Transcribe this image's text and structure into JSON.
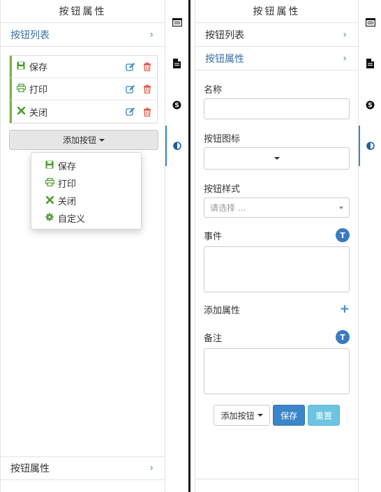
{
  "left_panel": {
    "title": "按钮属性",
    "nav_top": {
      "label": "按钮列表",
      "chevron": "›"
    },
    "buttons": [
      {
        "icon": "save-icon",
        "label": "保存"
      },
      {
        "icon": "print-icon",
        "label": "打印"
      },
      {
        "icon": "close-icon",
        "label": "关闭"
      }
    ],
    "add_button_label": "添加按钮",
    "dropdown": [
      {
        "icon": "save-icon",
        "label": "保存"
      },
      {
        "icon": "print-icon",
        "label": "打印"
      },
      {
        "icon": "close-icon",
        "label": "关闭"
      },
      {
        "icon": "gear-icon",
        "label": "自定义"
      }
    ],
    "nav_bottom": {
      "label": "按钮属性",
      "chevron": "›"
    }
  },
  "rail_icons": [
    "list-icon",
    "document-icon",
    "skype-icon",
    "contrast-icon"
  ],
  "right_panel": {
    "title": "按钮属性",
    "nav_list": {
      "label": "按钮列表",
      "chevron": "›"
    },
    "nav_props": {
      "label": "按钮属性",
      "chevron": "›"
    },
    "fields": {
      "name_label": "名称",
      "icon_label": "按钮图标",
      "style_label": "按钮样式",
      "style_placeholder": "请选择 ...",
      "event_label": "事件",
      "add_attr_label": "添加属性",
      "note_label": "备注",
      "t_badge": "T",
      "plus": "+"
    },
    "footer": {
      "add_button_label": "添加按钮",
      "save_label": "保存",
      "reset_label": "重置"
    }
  },
  "colors": {
    "accent": "#3a86c8",
    "link": "#3a6fa5",
    "icon_green": "#4a9c2c",
    "delete_red": "#e05a4f",
    "edit_blue": "#3a86c8",
    "reset": "#6cc4e0"
  }
}
